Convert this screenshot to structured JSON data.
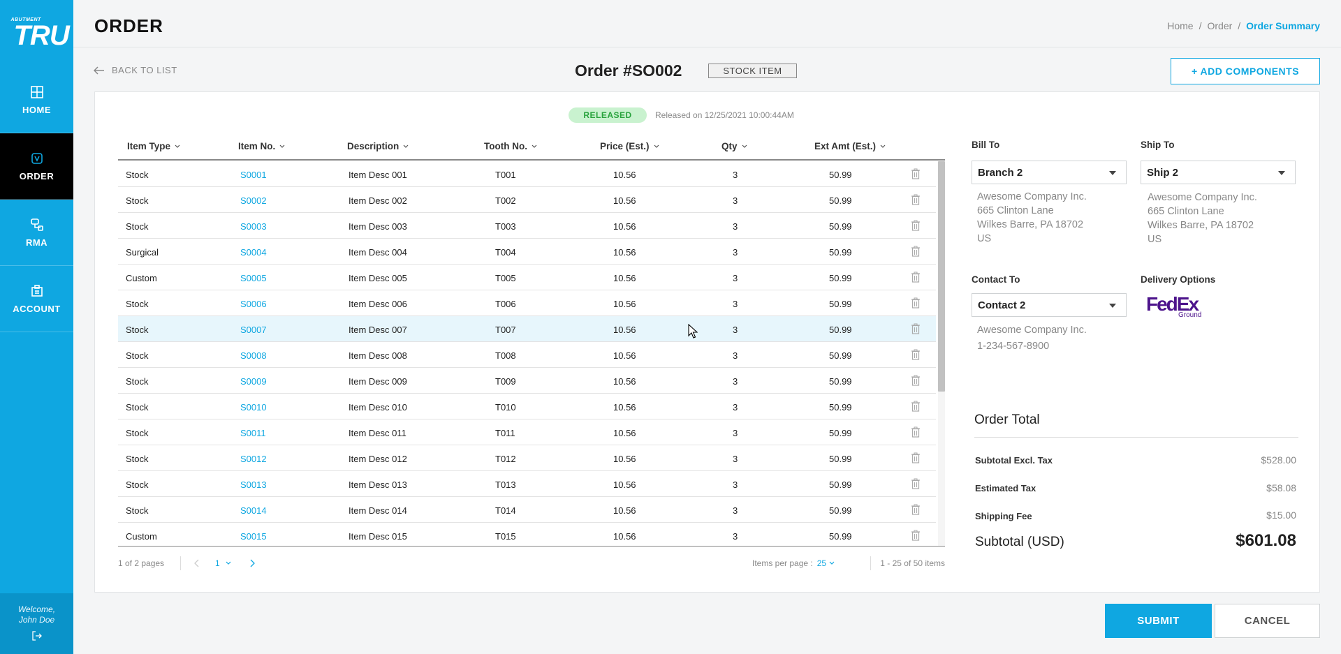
{
  "brand": {
    "small": "ABUTMENT",
    "big": "TRU"
  },
  "sidebar": {
    "items": [
      {
        "label": "HOME",
        "icon": "home-icon"
      },
      {
        "label": "ORDER",
        "icon": "order-icon"
      },
      {
        "label": "RMA",
        "icon": "rma-icon"
      },
      {
        "label": "ACCOUNT",
        "icon": "account-icon"
      }
    ],
    "active": "ORDER",
    "welcome_line1": "Welcome,",
    "welcome_line2": "John Doe"
  },
  "header": {
    "title": "ORDER",
    "breadcrumb": [
      "Home",
      "Order",
      "Order Summary"
    ]
  },
  "order": {
    "back_label": "BACK TO LIST",
    "title": "Order #SO002",
    "chip": "STOCK ITEM",
    "add_components_label": "+ ADD COMPONENTS",
    "status": "RELEASED",
    "released_on": "Released on 12/25/2021 10:00:44AM"
  },
  "table": {
    "columns": [
      "Item Type",
      "Item No.",
      "Description",
      "Tooth No.",
      "Price (Est.)",
      "Qty",
      "Ext Amt (Est.)"
    ],
    "rows": [
      {
        "type": "Stock",
        "item": "S0001",
        "desc": "Item Desc 001",
        "tooth": "T001",
        "price": "10.56",
        "qty": "3",
        "ext": "50.99"
      },
      {
        "type": "Stock",
        "item": "S0002",
        "desc": "Item Desc 002",
        "tooth": "T002",
        "price": "10.56",
        "qty": "3",
        "ext": "50.99"
      },
      {
        "type": "Stock",
        "item": "S0003",
        "desc": "Item Desc 003",
        "tooth": "T003",
        "price": "10.56",
        "qty": "3",
        "ext": "50.99"
      },
      {
        "type": "Surgical",
        "item": "S0004",
        "desc": "Item Desc 004",
        "tooth": "T004",
        "price": "10.56",
        "qty": "3",
        "ext": "50.99"
      },
      {
        "type": "Custom",
        "item": "S0005",
        "desc": "Item Desc 005",
        "tooth": "T005",
        "price": "10.56",
        "qty": "3",
        "ext": "50.99"
      },
      {
        "type": "Stock",
        "item": "S0006",
        "desc": "Item Desc 006",
        "tooth": "T006",
        "price": "10.56",
        "qty": "3",
        "ext": "50.99"
      },
      {
        "type": "Stock",
        "item": "S0007",
        "desc": "Item Desc 007",
        "tooth": "T007",
        "price": "10.56",
        "qty": "3",
        "ext": "50.99"
      },
      {
        "type": "Stock",
        "item": "S0008",
        "desc": "Item Desc 008",
        "tooth": "T008",
        "price": "10.56",
        "qty": "3",
        "ext": "50.99"
      },
      {
        "type": "Stock",
        "item": "S0009",
        "desc": "Item Desc 009",
        "tooth": "T009",
        "price": "10.56",
        "qty": "3",
        "ext": "50.99"
      },
      {
        "type": "Stock",
        "item": "S0010",
        "desc": "Item Desc 010",
        "tooth": "T010",
        "price": "10.56",
        "qty": "3",
        "ext": "50.99"
      },
      {
        "type": "Stock",
        "item": "S0011",
        "desc": "Item Desc 011",
        "tooth": "T011",
        "price": "10.56",
        "qty": "3",
        "ext": "50.99"
      },
      {
        "type": "Stock",
        "item": "S0012",
        "desc": "Item Desc 012",
        "tooth": "T012",
        "price": "10.56",
        "qty": "3",
        "ext": "50.99"
      },
      {
        "type": "Stock",
        "item": "S0013",
        "desc": "Item Desc 013",
        "tooth": "T013",
        "price": "10.56",
        "qty": "3",
        "ext": "50.99"
      },
      {
        "type": "Stock",
        "item": "S0014",
        "desc": "Item Desc 014",
        "tooth": "T014",
        "price": "10.56",
        "qty": "3",
        "ext": "50.99"
      },
      {
        "type": "Custom",
        "item": "S0015",
        "desc": "Item Desc 015",
        "tooth": "T015",
        "price": "10.56",
        "qty": "3",
        "ext": "50.99"
      }
    ],
    "hovered_row": 6
  },
  "pagination": {
    "pages_text": "1 of 2 pages",
    "current_page": "1",
    "items_per_page_label": "Items per page :",
    "items_per_page": "25",
    "range_text": "1 - 25 of 50 items"
  },
  "bill_to": {
    "label": "Bill To",
    "selected": "Branch 2",
    "address": [
      "Awesome Company Inc.",
      "665 Clinton Lane",
      "Wilkes Barre, PA 18702",
      "US"
    ]
  },
  "ship_to": {
    "label": "Ship To",
    "selected": "Ship 2",
    "address": [
      "Awesome Company Inc.",
      "665 Clinton Lane",
      "Wilkes Barre, PA 18702",
      "US"
    ]
  },
  "contact_to": {
    "label": "Contact To",
    "selected": "Contact 2",
    "details": [
      "Awesome Company Inc.",
      "1-234-567-8900"
    ]
  },
  "delivery": {
    "label": "Delivery Options",
    "logo_main_fe": "Fed",
    "logo_main_ex": "Ex",
    "logo_sub": "Ground"
  },
  "totals": {
    "title": "Order Total",
    "lines": [
      {
        "label": "Subtotal Excl. Tax",
        "value": "$528.00"
      },
      {
        "label": "Estimated Tax",
        "value": "$58.08"
      },
      {
        "label": "Shipping Fee",
        "value": "$15.00"
      }
    ],
    "grand_label": "Subtotal (USD)",
    "grand_value": "$601.08"
  },
  "actions": {
    "submit": "SUBMIT",
    "cancel": "CANCEL"
  },
  "colors": {
    "accent": "#0fa7e1",
    "released_bg": "#c9f2cf",
    "released_text": "#29a33d",
    "fedex_purple": "#4d148c"
  }
}
